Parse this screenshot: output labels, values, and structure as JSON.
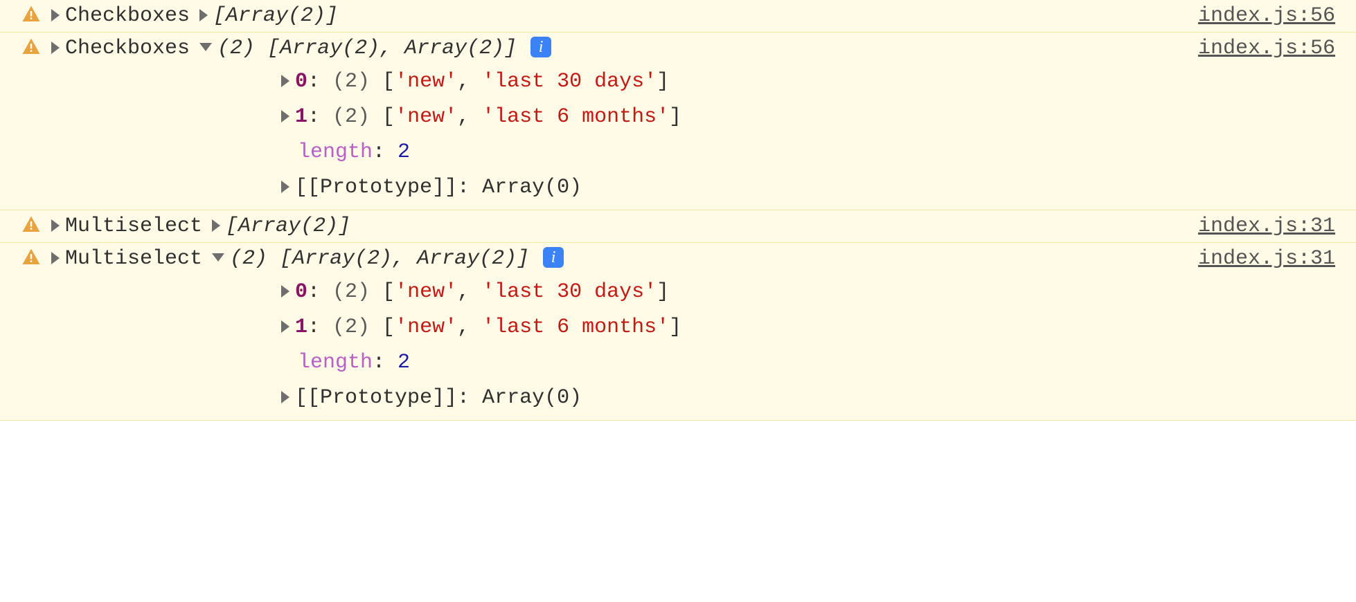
{
  "rows": [
    {
      "label": "Checkboxes",
      "expanded": false,
      "preview": "[Array(2)]",
      "source": "index.js:56"
    },
    {
      "label": "Checkboxes",
      "expanded": true,
      "preview_count": "(2)",
      "preview": "[Array(2), Array(2)]",
      "source": "index.js:56",
      "children": {
        "items": [
          {
            "index": "0",
            "count": "(2)",
            "vals": [
              "'new'",
              "'last 30 days'"
            ]
          },
          {
            "index": "1",
            "count": "(2)",
            "vals": [
              "'new'",
              "'last 6 months'"
            ]
          }
        ],
        "length_label": "length",
        "length_value": "2",
        "proto_label": "[[Prototype]]",
        "proto_value": "Array(0)"
      }
    },
    {
      "label": "Multiselect",
      "expanded": false,
      "preview": "[Array(2)]",
      "source": "index.js:31"
    },
    {
      "label": "Multiselect",
      "expanded": true,
      "preview_count": "(2)",
      "preview": "[Array(2), Array(2)]",
      "source": "index.js:31",
      "children": {
        "items": [
          {
            "index": "0",
            "count": "(2)",
            "vals": [
              "'new'",
              "'last 30 days'"
            ]
          },
          {
            "index": "1",
            "count": "(2)",
            "vals": [
              "'new'",
              "'last 6 months'"
            ]
          }
        ],
        "length_label": "length",
        "length_value": "2",
        "proto_label": "[[Prototype]]",
        "proto_value": "Array(0)"
      }
    }
  ],
  "info_glyph": "i"
}
